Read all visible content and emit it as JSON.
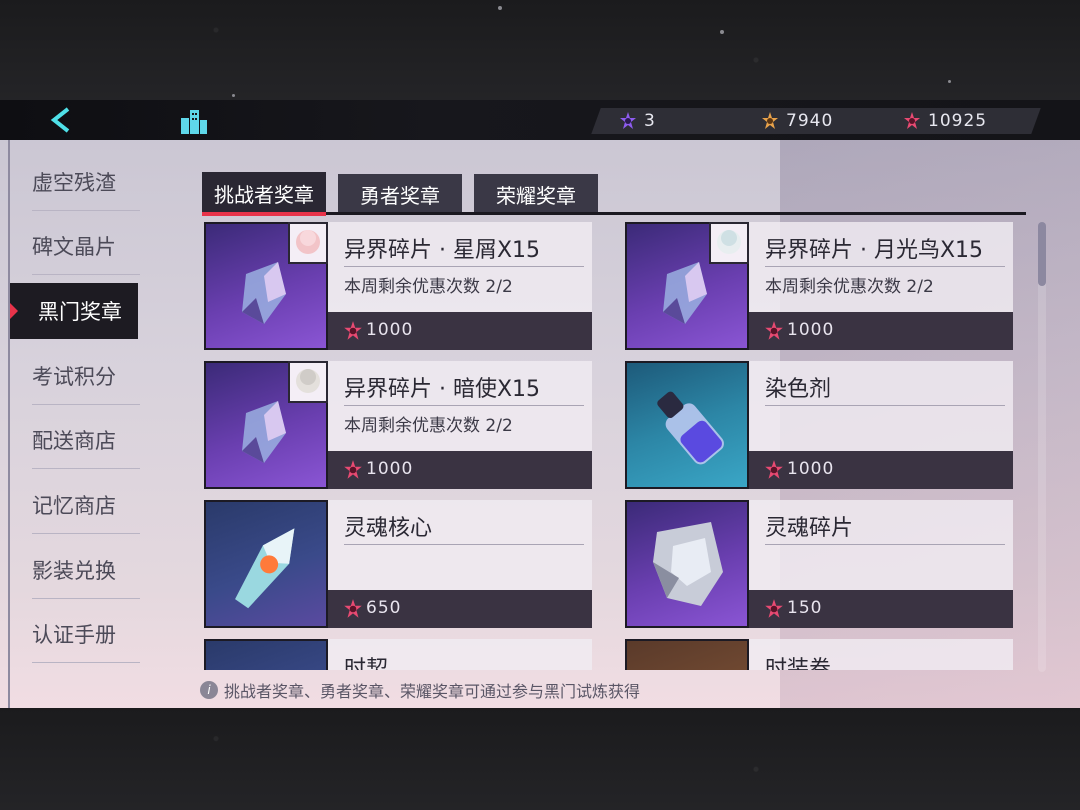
{
  "currencies": [
    {
      "icon": "purple-gem-icon",
      "value": "3"
    },
    {
      "icon": "gold-medal-icon",
      "value": "7940"
    },
    {
      "icon": "red-medal-icon",
      "value": "10925"
    }
  ],
  "sidebar": {
    "items": [
      {
        "label": "虚空残渣"
      },
      {
        "label": "碑文晶片"
      },
      {
        "label": "黑门奖章"
      },
      {
        "label": "考试积分"
      },
      {
        "label": "配送商店"
      },
      {
        "label": "记忆商店"
      },
      {
        "label": "影装兑换"
      },
      {
        "label": "认证手册"
      }
    ],
    "active_index": 2
  },
  "tabs": [
    {
      "label": "挑战者奖章"
    },
    {
      "label": "勇者奖章"
    },
    {
      "label": "荣耀奖章"
    }
  ],
  "items": [
    {
      "name": "异界碎片 · 星屑X15",
      "desc": "本周剩余优惠次数 2/2",
      "price": "1000"
    },
    {
      "name": "异界碎片 · 月光鸟X15",
      "desc": "本周剩余优惠次数 2/2",
      "price": "1000"
    },
    {
      "name": "异界碎片 · 暗使X15",
      "desc": "本周剩余优惠次数 2/2",
      "price": "1000"
    },
    {
      "name": "染色剂",
      "desc": "",
      "price": "1000"
    },
    {
      "name": "灵魂核心",
      "desc": "",
      "price": "650"
    },
    {
      "name": "灵魂碎片",
      "desc": "",
      "price": "150"
    },
    {
      "name": "时契",
      "desc": "",
      "price": ""
    },
    {
      "name": "时装卷",
      "desc": "",
      "price": ""
    }
  ],
  "notice": "挑战者奖章、勇者奖章、荣耀奖章可通过参与黑门试炼获得",
  "colors": {
    "accent": "#e8334a",
    "panel_dark": "#1d1b22"
  }
}
